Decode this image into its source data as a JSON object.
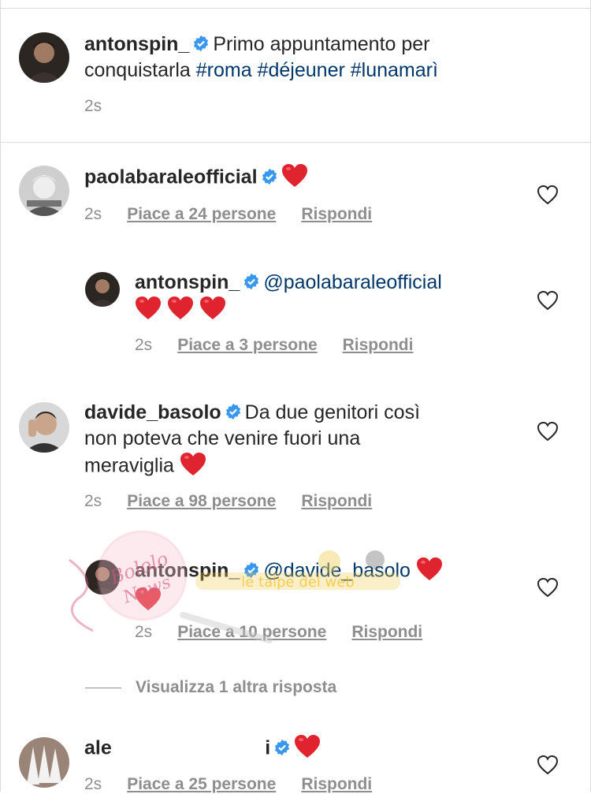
{
  "caption": {
    "username": "antonspin_",
    "text_line1": "Primo appuntamento per",
    "text_line2": "conquistarla",
    "hashtags": [
      "#roma",
      "#déjeuner",
      "#lunamarì"
    ],
    "time": "2s"
  },
  "comments": [
    {
      "username": "paolabaraleofficial",
      "time": "2s",
      "likes": "Piace a 24 persone",
      "reply": "Rispondi"
    },
    {
      "username": "antonspin_",
      "mention": "@paolabaraleofficial",
      "time": "2s",
      "likes": "Piace a 3 persone",
      "reply": "Rispondi"
    },
    {
      "username": "davide_basolo",
      "text_line1": "Da due genitori così",
      "text_line2": "non poteva che venire fuori una",
      "text_line3": "meraviglia",
      "time": "2s",
      "likes": "Piace a 98 persone",
      "reply": "Rispondi"
    },
    {
      "username": "antonspin_",
      "mention": "@davide_basolo",
      "time": "2s",
      "likes": "Piace a 10 persone",
      "reply": "Rispondi"
    },
    {
      "username": "alessandrarecchizzi",
      "time": "2s",
      "likes": "Piace a 25 persone",
      "reply": "Rispondi"
    }
  ],
  "view_more": "Visualizza 1 altra risposta",
  "watermark": {
    "circle_text": "Bololo News",
    "banner_text": "le talpe del web"
  },
  "colors": {
    "text": "#262626",
    "secondary": "#8e8e8e",
    "link": "#00376b",
    "verified": "#3897f0",
    "heart": "#e0242f"
  }
}
